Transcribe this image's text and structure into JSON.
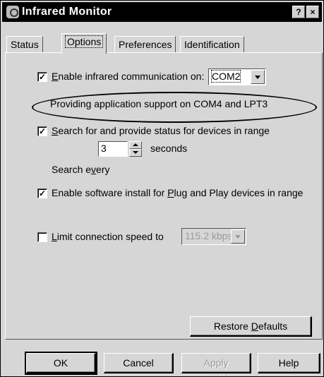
{
  "window": {
    "title": "Infrared Monitor",
    "help_button": "?",
    "close_button": "×"
  },
  "tabs": [
    {
      "label": "Status"
    },
    {
      "label": "Options",
      "active": true
    },
    {
      "label": "Preferences"
    },
    {
      "label": "Identification"
    }
  ],
  "options": {
    "enable_ir": {
      "checked": true,
      "label_mnemonic": "E",
      "label_rest": "nable infrared communication on:"
    },
    "port_select": {
      "value": "COM2"
    },
    "support_note": "Providing application support on COM4 and LPT3",
    "search_devices": {
      "checked": true,
      "label_mnemonic": "S",
      "label_rest": "earch for and provide status for devices in range"
    },
    "search_every": {
      "label_pre": "Search e",
      "label_mnemonic": "v",
      "label_post": "ery",
      "value": "3",
      "unit": "seconds"
    },
    "software_install": {
      "checked": true,
      "label_pre": "Enable software install for ",
      "label_mnemonic": "P",
      "label_post": "lug and Play devices in range"
    },
    "limit_speed": {
      "checked": false,
      "label_mnemonic": "L",
      "label_rest": "imit connection speed to",
      "value": "115.2 kbps"
    },
    "restore_defaults": {
      "label_pre": "Restore ",
      "label_mnemonic": "D",
      "label_post": "efaults"
    }
  },
  "buttons": {
    "ok": "OK",
    "cancel": "Cancel",
    "apply": "Apply",
    "help": "Help"
  }
}
